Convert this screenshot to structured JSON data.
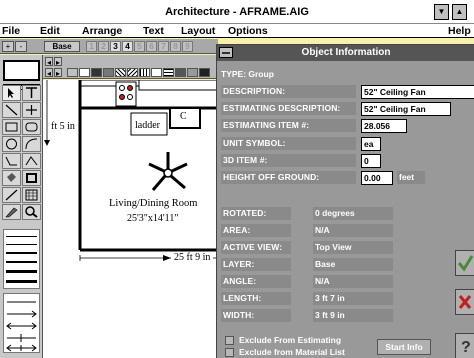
{
  "app": {
    "title": "Architecture - AFRAME.AIG"
  },
  "menu": {
    "items": [
      "File",
      "Edit",
      "Arrange",
      "Text",
      "Layout",
      "Options"
    ],
    "help": "Help"
  },
  "layer_strip": {
    "active_layer": "Base",
    "layer_numbers": [
      "1",
      "2",
      "3",
      "4",
      "5",
      "6",
      "7",
      "8",
      "9"
    ],
    "selected_layers": [
      "3",
      "4"
    ]
  },
  "canvas": {
    "dimension_left": "ft 5 in",
    "dimension_bottom": "25 ft 9 in",
    "ladder_label": "ladder",
    "c_label": "C",
    "room_name": "Living/Dining Room",
    "room_size": "25'3\"x14'11\""
  },
  "dialog": {
    "title": "Object Information",
    "type_label": "TYPE: Group",
    "description_label": "DESCRIPTION:",
    "description_value": "52\" Ceiling Fan",
    "estimating_description_label": "ESTIMATING DESCRIPTION:",
    "estimating_description_value": "52\" Ceiling Fan",
    "estimating_item_label": "ESTIMATING ITEM #:",
    "estimating_item_value": "28.056",
    "unit_symbol_label": "UNIT SYMBOL:",
    "unit_symbol_value": "ea",
    "item_3d_label": "3D ITEM #:",
    "item_3d_value": "0",
    "height_label": "HEIGHT OFF GROUND:",
    "height_value": "0.00",
    "height_unit": "feet",
    "rotated_label": "ROTATED:",
    "rotated_value": "0 degrees",
    "area_label": "AREA:",
    "area_value": "N/A",
    "active_view_label": "ACTIVE VIEW:",
    "active_view_value": "Top View",
    "layer_label": "LAYER:",
    "layer_value": "Base",
    "angle_label": "ANGLE:",
    "angle_value": "N/A",
    "length_label": "LENGTH:",
    "length_value": "3 ft 7 in",
    "width_label": "WIDTH:",
    "width_value": "3 ft 9 in",
    "exclude_estimating_label": "Exclude From Estimating",
    "exclude_material_label": "Exclude from Material List",
    "start_info_label": "Start Info",
    "exclude_estimating_checked": false,
    "exclude_material_checked": false
  },
  "icons": [
    "check-icon",
    "x-icon",
    "question-icon",
    "pointer-icon",
    "text-tool-icon",
    "ceiling-fan-icon"
  ],
  "colors": {
    "desktop": "#f6f2a8",
    "dialog_bg": "#999999",
    "dialog_title": "#555555",
    "label_bg": "#8a8a8a",
    "check_green": "#4a8a3a",
    "x_red": "#c02020"
  }
}
